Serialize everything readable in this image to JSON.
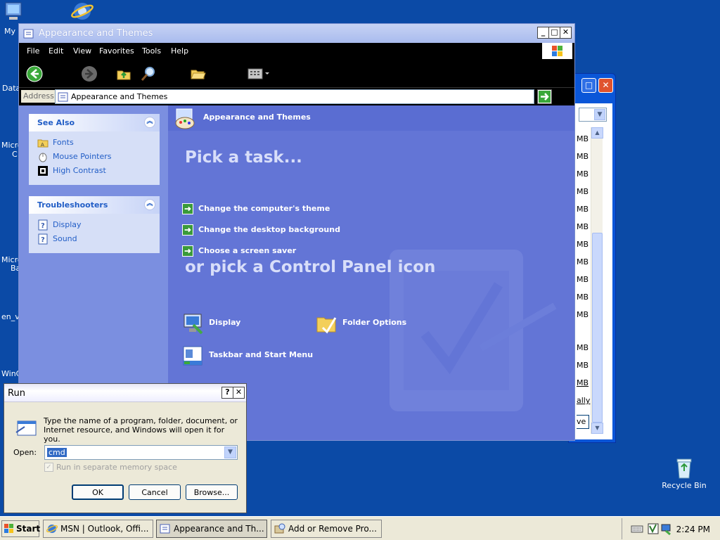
{
  "desktop": {
    "icons": [
      {
        "label": "My"
      },
      {
        "label": "Data"
      },
      {
        "label": "Micro"
      },
      {
        "label": "C"
      },
      {
        "label": "Micro"
      },
      {
        "label": "Ba"
      },
      {
        "label": "en_v"
      },
      {
        "label": "WinC"
      }
    ],
    "recycle_bin": "Recycle Bin"
  },
  "bg_window": {
    "sizes": [
      "MB",
      "MB",
      "MB",
      "MB",
      "MB",
      "MB",
      "MB",
      "MB",
      "MB",
      "MB",
      "MB",
      "",
      "MB",
      "MB",
      "MB"
    ],
    "link": "ally",
    "button_frag": "ve"
  },
  "main_window": {
    "title": "Appearance and Themes",
    "menu": [
      "File",
      "Edit",
      "View",
      "Favorites",
      "Tools",
      "Help"
    ],
    "address_label": "Address",
    "address_value": "Appearance and Themes",
    "see_also": {
      "title": "See Also",
      "items": [
        "Fonts",
        "Mouse Pointers",
        "High Contrast"
      ]
    },
    "troubleshooters": {
      "title": "Troubleshooters",
      "items": [
        "Display",
        "Sound"
      ]
    },
    "header_title": "Appearance and Themes",
    "pick_task": "Pick a task...",
    "tasks": [
      "Change the computer's theme",
      "Change the desktop background",
      "Choose a screen saver"
    ],
    "pick_icon": "or pick a Control Panel icon",
    "icons": [
      "Display",
      "Folder Options",
      "Taskbar and Start Menu"
    ]
  },
  "run_dialog": {
    "title": "Run",
    "description": "Type the name of a program, folder, document, or Internet resource, and Windows will open it for you.",
    "open_label": "Open:",
    "open_value": "cmd",
    "checkbox_label": "Run in separate memory space",
    "ok": "OK",
    "cancel": "Cancel",
    "browse": "Browse..."
  },
  "taskbar": {
    "start": "Start",
    "tasks": [
      "MSN | Outlook, Offi...",
      "Appearance and Th...",
      "Add or Remove Pro..."
    ],
    "clock": "2:24 PM"
  }
}
